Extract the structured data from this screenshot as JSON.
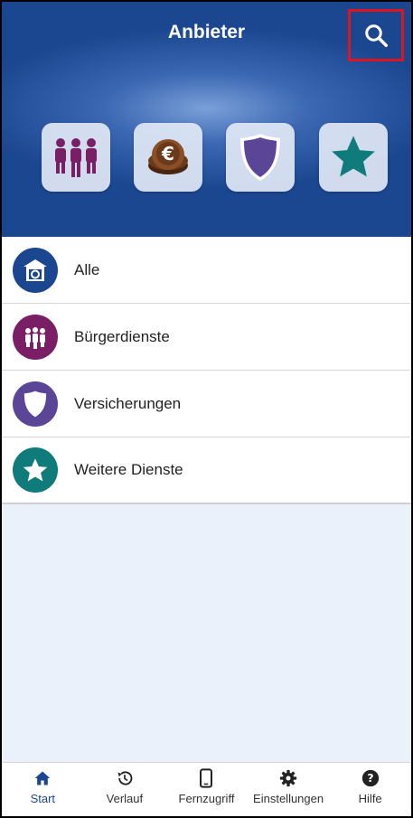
{
  "header": {
    "title": "Anbieter",
    "search_icon": "search-icon",
    "background_color": "#1b4690",
    "highlight_color": "#e0141e"
  },
  "category_tiles": [
    {
      "icon": "people-icon",
      "color": "#7a1f65"
    },
    {
      "icon": "euro-coin-icon",
      "color": "#6b3a1a"
    },
    {
      "icon": "shield-icon",
      "color": "#5a4596"
    },
    {
      "icon": "star-icon",
      "color": "#0f7b7b"
    }
  ],
  "list": {
    "items": [
      {
        "label": "Alle",
        "icon": "all-services-icon",
        "color": "#1b4690"
      },
      {
        "label": "Bürgerdienste",
        "icon": "people-icon",
        "color": "#7a1f65"
      },
      {
        "label": "Versicherungen",
        "icon": "shield-icon",
        "color": "#5a4596"
      },
      {
        "label": "Weitere Dienste",
        "icon": "star-icon",
        "color": "#0f7b7b"
      }
    ]
  },
  "bottom_nav": {
    "items": [
      {
        "label": "Start",
        "icon": "home-icon",
        "active": true
      },
      {
        "label": "Verlauf",
        "icon": "history-icon",
        "active": false
      },
      {
        "label": "Fernzugriff",
        "icon": "phone-icon",
        "active": false
      },
      {
        "label": "Einstellungen",
        "icon": "gear-icon",
        "active": false
      },
      {
        "label": "Hilfe",
        "icon": "help-icon",
        "active": false
      }
    ],
    "active_color": "#1b4690"
  }
}
